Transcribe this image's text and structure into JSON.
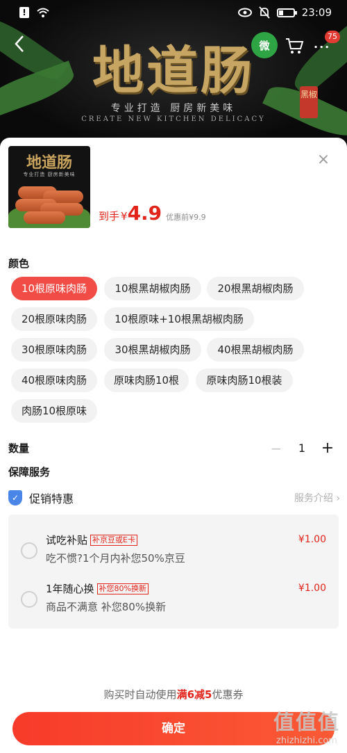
{
  "status_bar": {
    "time": "23:09"
  },
  "banner": {
    "title": "地道肠",
    "subtitle": "专业打造  厨房新美味",
    "english": "CREATE NEW KITCHEN DELICACY",
    "seal": "黑椒",
    "wechat_label": "微",
    "cart_badge": "75",
    "more": "···"
  },
  "product": {
    "thumb_title": "地道肠",
    "thumb_subtitle": "专业打造 厨房新美味",
    "price_prefix": "到手",
    "price_symbol": "¥",
    "price": "4.9",
    "original_price": "优惠前¥9.9"
  },
  "sheet": {
    "close": "×"
  },
  "color_section": {
    "label": "颜色",
    "selected_index": 0,
    "options": [
      "10根原味肉肠",
      "10根黑胡椒肉肠",
      "20根黑胡椒肉肠",
      "20根原味肉肠",
      "10根原味+10根黑胡椒肉肠",
      "30根原味肉肠",
      "30根黑胡椒肉肠",
      "40根黑胡椒肉肠",
      "40根原味肉肠",
      "原味肉肠10根",
      "原味肉肠10根装",
      "肉肠10根原味"
    ]
  },
  "quantity": {
    "label": "数量",
    "minus": "−",
    "value": "1",
    "plus": "+"
  },
  "guarantee": {
    "label": "保障服务",
    "promo_title": "促销特惠",
    "promo_link": "服务介绍",
    "items": [
      {
        "name": "试吃补贴",
        "tag": "补京豆或E卡",
        "desc": "吃不惯?1个月内补您50%京豆",
        "price": "¥1.00"
      },
      {
        "name": "1年随心换",
        "tag": "补您80%换新",
        "desc": "商品不满意 补您80%换新",
        "price": "¥1.00"
      }
    ]
  },
  "footer": {
    "coupon_before": "购买时自动使用",
    "coupon_highlight": "满6减5",
    "coupon_after": "优惠券",
    "confirm": "确定",
    "watermark_icon": "值值值",
    "watermark_text": "zhizhizhi.com"
  },
  "colors": {
    "accent": "#e2231a",
    "chip_selected": "#f14c45",
    "chip_bg": "#f2f2f2",
    "shield": "#4a86e8"
  }
}
